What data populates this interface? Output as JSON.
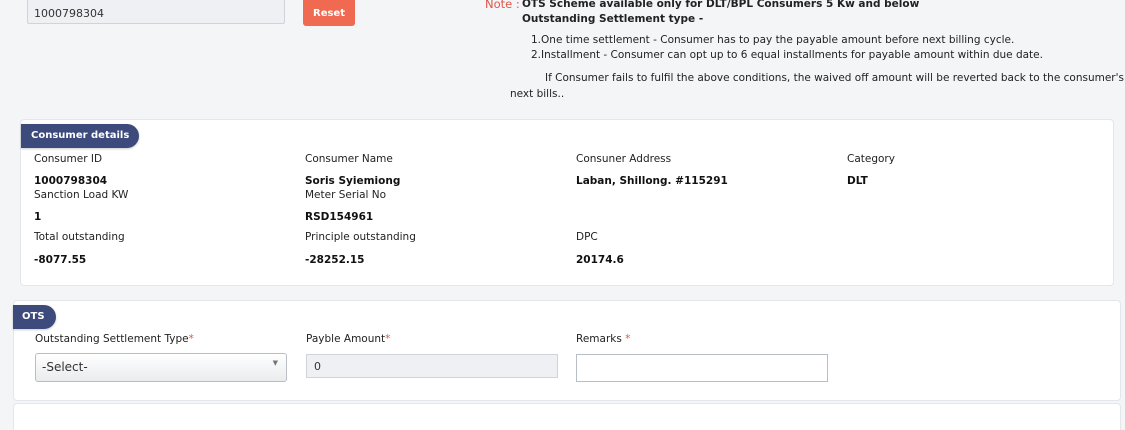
{
  "search": {
    "consumer_id_value": "1000798304",
    "reset_label": "Reset"
  },
  "note": {
    "label": "Note :",
    "line1": "OTS Scheme available only for DLT/BPL Consumers 5 Kw and below",
    "line2": "Outstanding Settlement type -",
    "line3": "1.One time settlement - Consumer has to pay the payable amount before next billing cycle.",
    "line4": "2.Installment - Consumer can opt up to 6 equal installments for payable amount within due date.",
    "line5": "If Consumer fails to fulfil the above conditions, the waived off amount will be reverted back to the consumer's",
    "line6": "next bills.."
  },
  "consumer_details": {
    "title": "Consumer details",
    "fields": [
      {
        "label": "Consumer ID",
        "value": "1000798304"
      },
      {
        "label": "Consumer Name",
        "value": "Soris Syiemiong"
      },
      {
        "label": "Consuner Address",
        "value": "Laban, Shillong. #115291"
      },
      {
        "label": "Category",
        "value": "DLT"
      },
      {
        "label": "Sanction Load KW",
        "value": "1"
      },
      {
        "label": "Meter Serial No",
        "value": "RSD154961"
      },
      {
        "label": "Total outstanding",
        "value": "-8077.55"
      },
      {
        "label": "Principle outstanding",
        "value": "-28252.15"
      },
      {
        "label": "DPC",
        "value": "20174.6"
      }
    ]
  },
  "ots": {
    "title": "OTS",
    "settlement_type_label": "Outstanding Settlement Type",
    "settlement_type_selected": "-Select-",
    "payable_label": "Payble Amount",
    "payable_value": "0",
    "remarks_label": "Remarks ",
    "remarks_value": "",
    "required_mark": "*"
  },
  "colors": {
    "accent": "#3c4a7c",
    "reset": "#ef6a50",
    "required": "#e0554a"
  },
  "icons": {
    "select_arrow": "chevron-down-icon"
  }
}
